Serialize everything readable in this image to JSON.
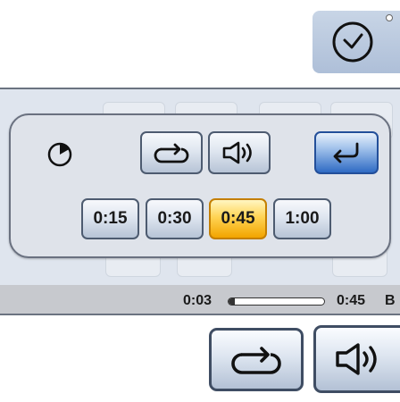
{
  "popup": {
    "timeouts": [
      {
        "label": "0:15",
        "selected": false
      },
      {
        "label": "0:30",
        "selected": false
      },
      {
        "label": "0:45",
        "selected": true
      },
      {
        "label": "1:00",
        "selected": false
      }
    ]
  },
  "status": {
    "elapsed": "0:03",
    "total": "0:45",
    "trailing_letter": "B",
    "progress_fraction": 0.067
  },
  "colors": {
    "accent_blue": "#2f6bc4",
    "selected_amber": "#f2a400",
    "panel_gray": "#dfe3ea"
  },
  "icons": {
    "top": "clock-icon",
    "timer": "pie-timer-icon",
    "repeat": "repeat-icon",
    "sound": "speaker-icon",
    "back": "return-arrow-icon"
  }
}
